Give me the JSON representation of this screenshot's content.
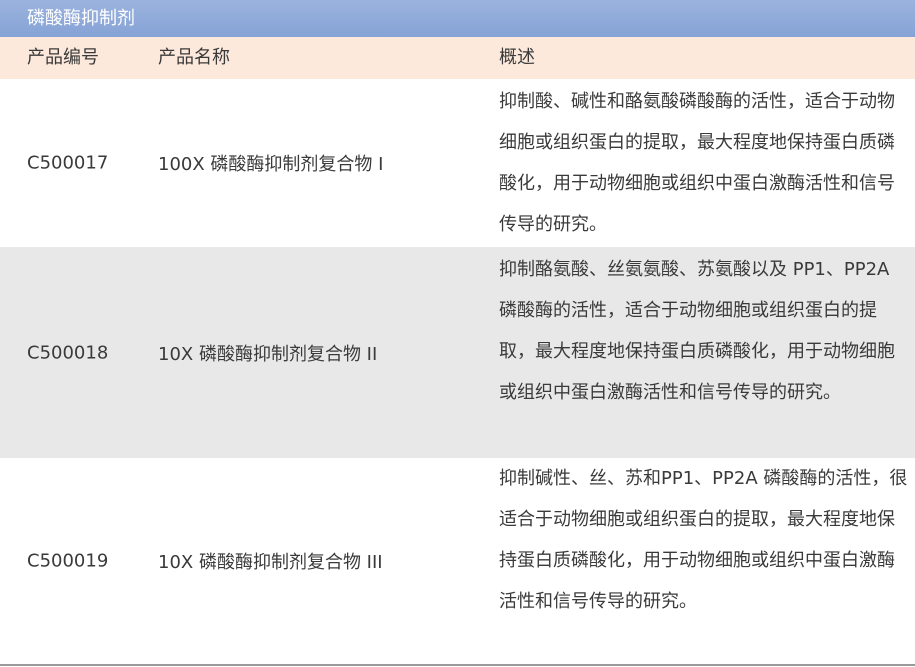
{
  "title": "磷酸酶抑制剂",
  "headers": {
    "code": "产品编号",
    "name": "产品名称",
    "desc": "概述"
  },
  "rows": [
    {
      "code": "C500017",
      "name": "100X 磷酸酶抑制剂复合物 I",
      "desc": "抑制酸、碱性和酪氨酸磷酸酶的活性，适合于动物细胞或组织蛋白的提取，最大程度地保持蛋白质磷酸化，用于动物细胞或组织中蛋白激酶活性和信号传导的研究。"
    },
    {
      "code": "C500018",
      "name": "10X 磷酸酶抑制剂复合物 II",
      "desc": "抑制酪氨酸、丝氨氨酸、苏氨酸以及 PP1、PP2A 磷酸酶的活性，适合于动物细胞或组织蛋白的提取，最大程度地保持蛋白质磷酸化，用于动物细胞或组织中蛋白激酶活性和信号传导的研究。"
    },
    {
      "code": "C500019",
      "name": "10X 磷酸酶抑制剂复合物 III",
      "desc": "抑制碱性、丝、苏和PP1、PP2A 磷酸酶的活性，很适合于动物细胞或组织蛋白的提取，最大程度地保持蛋白质磷酸化，用于动物细胞或组织中蛋白激酶活性和信号传导的研究。"
    }
  ]
}
